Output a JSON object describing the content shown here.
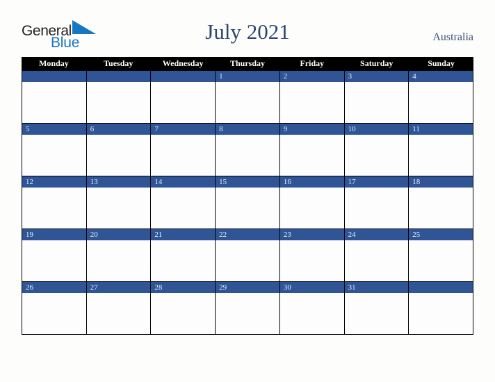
{
  "brand": {
    "name_part1": "General",
    "name_part2": "Blue",
    "triangle_icon": "blue-triangle-icon",
    "color_dark": "#231f20",
    "color_blue": "#1577c4"
  },
  "header": {
    "title": "July 2021",
    "country": "Australia",
    "title_color": "#2e4570"
  },
  "calendar": {
    "month": "July",
    "year": "2021",
    "accent_color": "#2f5597",
    "header_bg": "#000000",
    "weekdays": [
      "Monday",
      "Tuesday",
      "Wednesday",
      "Thursday",
      "Friday",
      "Saturday",
      "Sunday"
    ],
    "weeks": [
      [
        {
          "day": ""
        },
        {
          "day": ""
        },
        {
          "day": ""
        },
        {
          "day": "1"
        },
        {
          "day": "2"
        },
        {
          "day": "3"
        },
        {
          "day": "4"
        }
      ],
      [
        {
          "day": "5"
        },
        {
          "day": "6"
        },
        {
          "day": "7"
        },
        {
          "day": "8"
        },
        {
          "day": "9"
        },
        {
          "day": "10"
        },
        {
          "day": "11"
        }
      ],
      [
        {
          "day": "12"
        },
        {
          "day": "13"
        },
        {
          "day": "14"
        },
        {
          "day": "15"
        },
        {
          "day": "16"
        },
        {
          "day": "17"
        },
        {
          "day": "18"
        }
      ],
      [
        {
          "day": "19"
        },
        {
          "day": "20"
        },
        {
          "day": "21"
        },
        {
          "day": "22"
        },
        {
          "day": "23"
        },
        {
          "day": "24"
        },
        {
          "day": "25"
        }
      ],
      [
        {
          "day": "26"
        },
        {
          "day": "27"
        },
        {
          "day": "28"
        },
        {
          "day": "29"
        },
        {
          "day": "30"
        },
        {
          "day": "31"
        },
        {
          "day": ""
        }
      ]
    ]
  }
}
